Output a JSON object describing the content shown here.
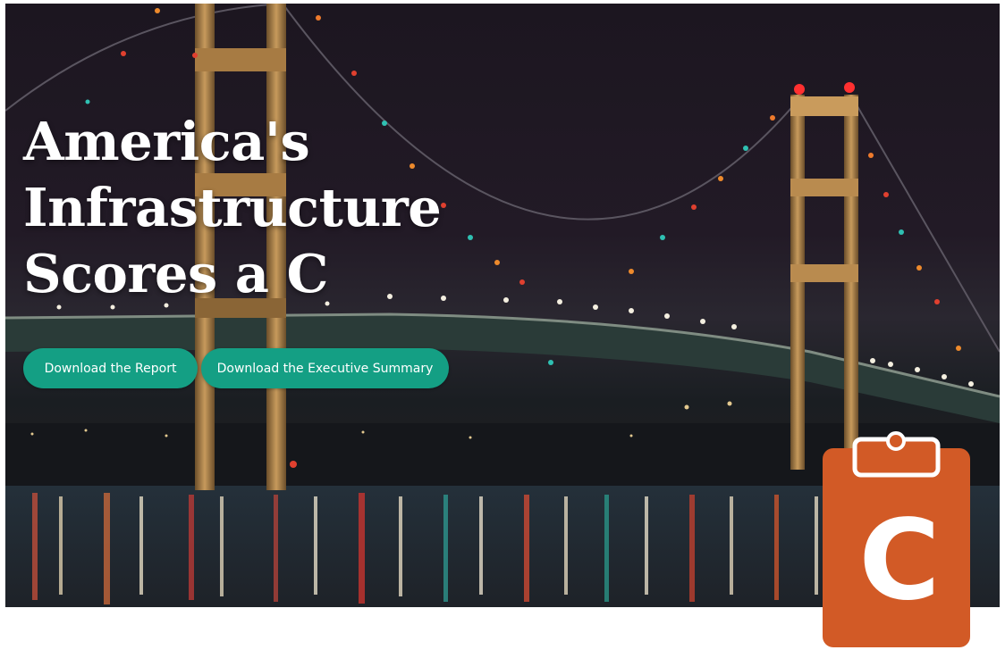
{
  "hero": {
    "headline_lines": [
      "America's",
      "Infrastructure",
      "Scores a C"
    ],
    "buttons": {
      "report_label": "Download the Report",
      "summary_label": "Download the Executive Summary"
    }
  },
  "grade_badge": {
    "letter": "C",
    "icon": "clipboard-icon"
  },
  "colors": {
    "button_green": "#149f84",
    "badge_orange": "#d25a26"
  }
}
